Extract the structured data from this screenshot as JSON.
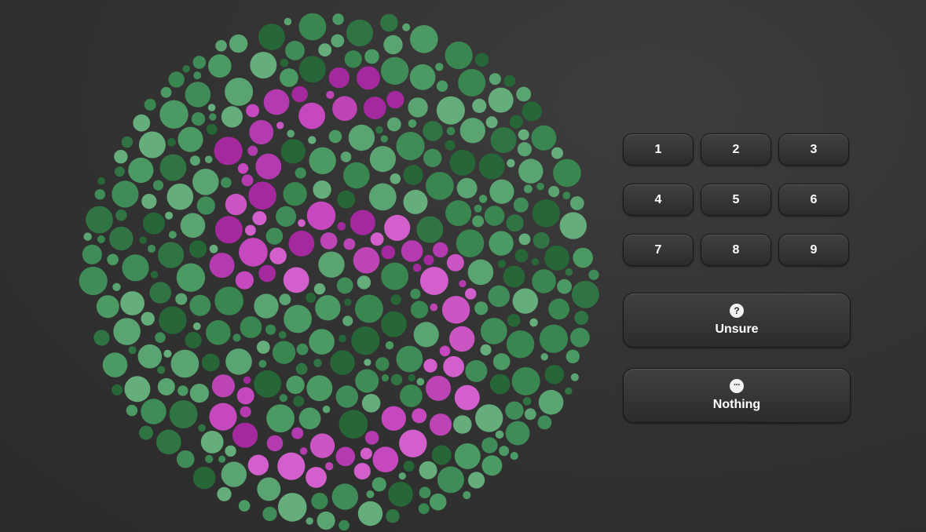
{
  "plate": {
    "colors": {
      "background_dots": [
        "#2f7442",
        "#3a8650",
        "#4c9a63",
        "#5aa472",
        "#266637",
        "#3f8c58",
        "#65ad7b"
      ],
      "figure_dots": [
        "#b43ab0",
        "#c548bf",
        "#d25fcb",
        "#a5299e",
        "#cc55c4",
        "#bd44b5"
      ]
    }
  },
  "digits": [
    "1",
    "2",
    "3",
    "4",
    "5",
    "6",
    "7",
    "8",
    "9"
  ],
  "unsure": {
    "icon": "question-icon",
    "glyph": "?",
    "label": "Unsure"
  },
  "nothing": {
    "icon": "ellipsis-icon",
    "glyph": "···",
    "label": "Nothing"
  }
}
